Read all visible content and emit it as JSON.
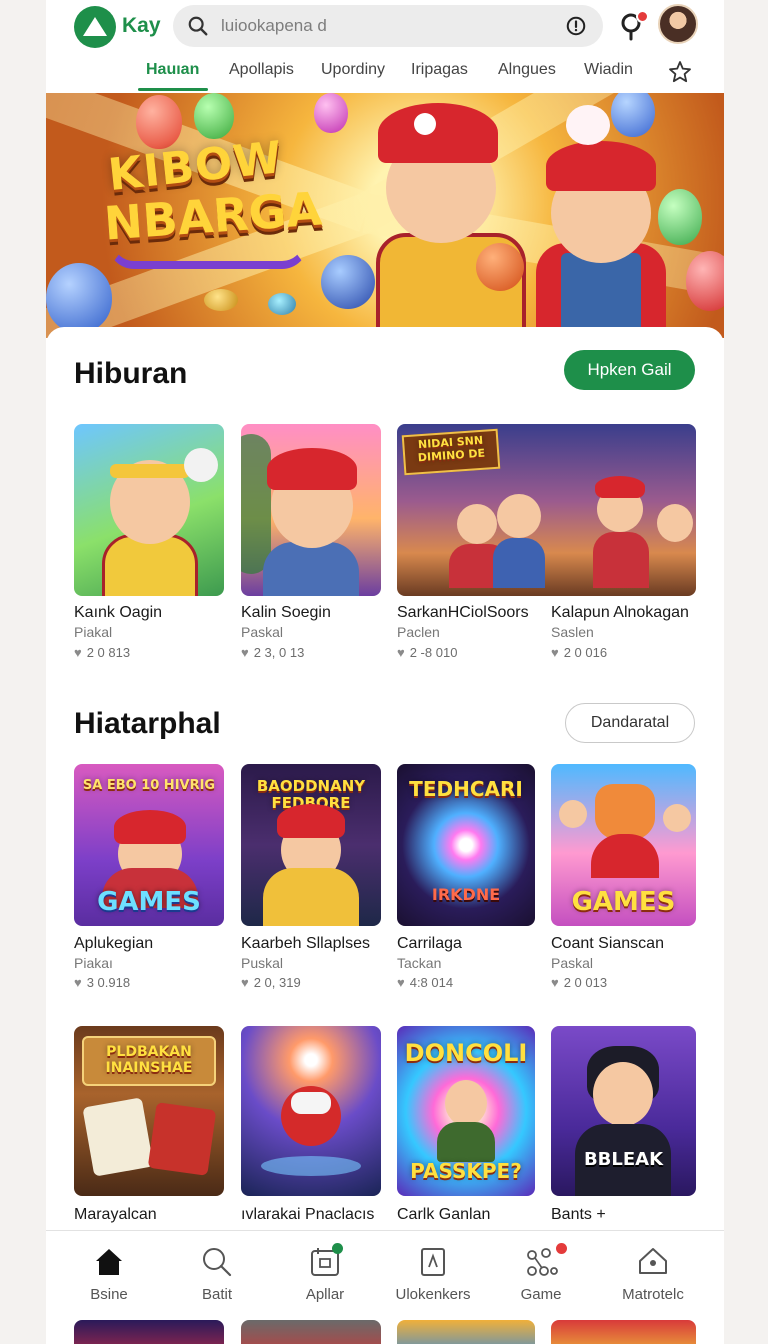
{
  "header": {
    "brand": "Kay",
    "search_placeholder": "luiookapena d",
    "accent_color": "#1e8f4a",
    "notification_color": "#e43b3b"
  },
  "tabs": [
    {
      "label": "Hauıan",
      "active": true
    },
    {
      "label": "Apollapis"
    },
    {
      "label": "Upordiny"
    },
    {
      "label": "Iripagas"
    },
    {
      "label": "Alngues"
    },
    {
      "label": "Wiadin"
    }
  ],
  "hero": {
    "title_line1": "KIBOW",
    "title_line2": "NBARGA"
  },
  "section1": {
    "title": "Hiburan",
    "button": "Ηpken Gail",
    "cards": [
      {
        "title": "Kaınk Oagin",
        "sub": "Piakal",
        "likes": "2 0 813"
      },
      {
        "title": "Kalin Soegin",
        "sub": "Paskal",
        "likes": "2 3, 0 13"
      },
      {
        "title": "SarkanHCiolSoors",
        "sub": "Paclen",
        "likes": "2 -8 010",
        "thumb_text": "NIDAI SNN DIMINO DE"
      },
      {
        "title": "Kalapun Alnokagan",
        "sub": "Saslen",
        "likes": "2 0 016"
      }
    ]
  },
  "section2": {
    "title": "Hiatarphal",
    "button": "Dandaratal",
    "cards": [
      {
        "title": "Aplukegian",
        "sub": "Piakaı",
        "likes": "3 0.918",
        "thumb_text": "GAMES",
        "thumb_top": "SA EBO 10 HIVRIG"
      },
      {
        "title": "Kaarbeh Sllaplses",
        "sub": "Puskal",
        "likes": "2 0, 319",
        "thumb_top": "BAODDNANY FEDBORE"
      },
      {
        "title": "Carrilaga",
        "sub": "Tackan",
        "likes": "4:8 014",
        "thumb_text": "IRKDNE",
        "thumb_top": "TEDHCARI"
      },
      {
        "title": "Coant Sianscan",
        "sub": "Paskal",
        "likes": "2 0 013",
        "thumb_text": "GAMES"
      }
    ]
  },
  "section3": {
    "cards": [
      {
        "title": "Marayalcan",
        "thumb_text": "PLDBAKAN INAINSHAE"
      },
      {
        "title": "ıvlarakai Pnaclacıs"
      },
      {
        "title": "Carlk Ganlan",
        "thumb_text": "DONCOLI",
        "thumb_bottom": "PASSKPE?"
      },
      {
        "title": "Bants +",
        "thumb_text": "BBLEAK"
      }
    ]
  },
  "bottom_nav": [
    {
      "label": "Bsine",
      "icon": "home-icon",
      "active": true
    },
    {
      "label": "Batit",
      "icon": "search-icon"
    },
    {
      "label": "Apllar",
      "icon": "apps-icon",
      "dot": "#1e8f4a"
    },
    {
      "label": "Ulokenkers",
      "icon": "bookmark-icon"
    },
    {
      "label": "Game",
      "icon": "game-icon",
      "dot": "#e43b3b"
    },
    {
      "label": "Matrotelc",
      "icon": "profile-icon"
    }
  ]
}
